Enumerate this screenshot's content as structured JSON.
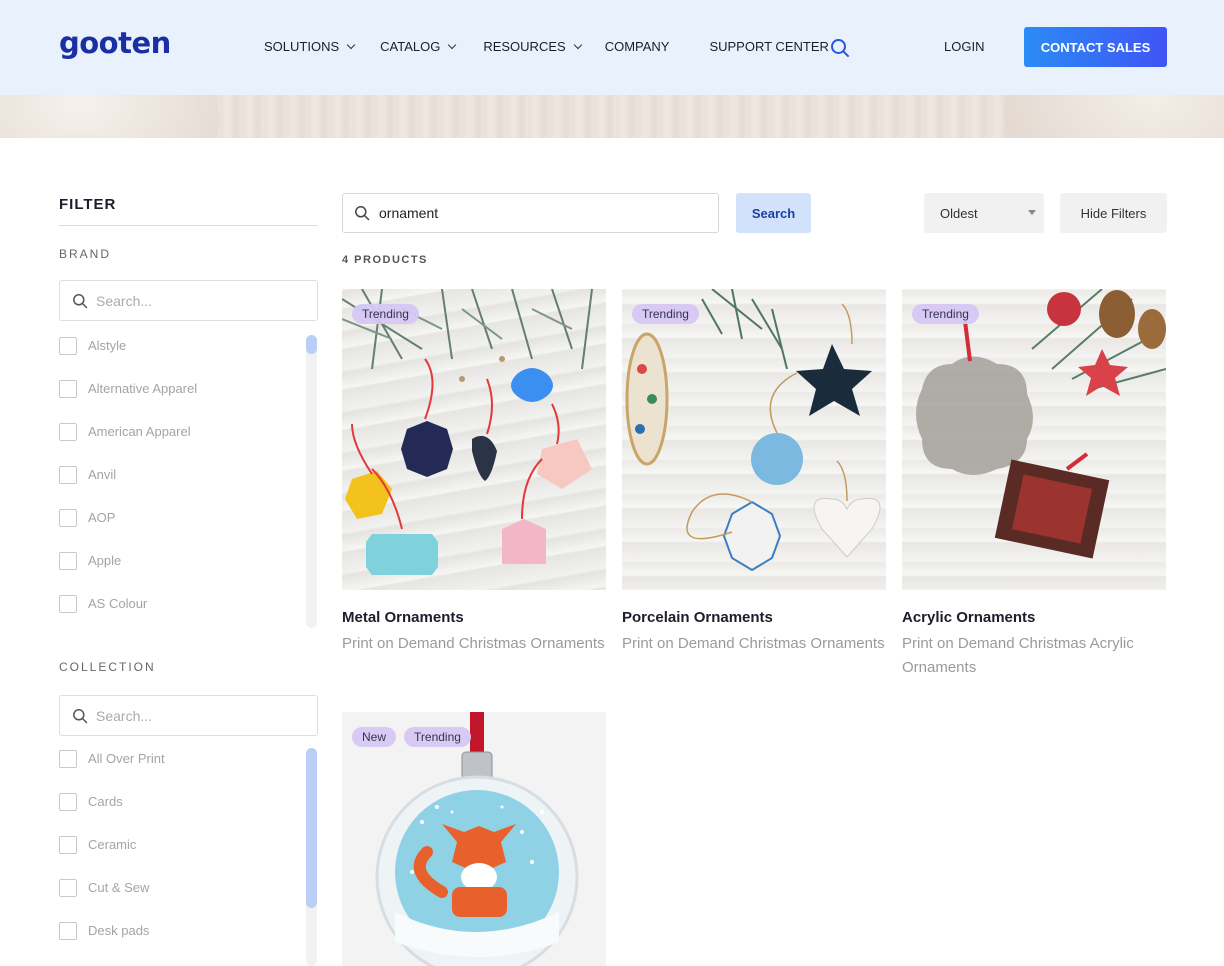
{
  "header": {
    "logo": "gooten",
    "nav": [
      {
        "label": "SOLUTIONS",
        "dropdown": true
      },
      {
        "label": "CATALOG",
        "dropdown": true
      },
      {
        "label": "RESOURCES",
        "dropdown": true
      },
      {
        "label": "COMPANY",
        "dropdown": false
      },
      {
        "label": "SUPPORT CENTER",
        "dropdown": false
      }
    ],
    "login": "LOGIN",
    "contact": "CONTACT SALES",
    "colors": {
      "bg": "#e9f1fc",
      "logo": "#1a2fa3",
      "cta_from": "#2a8cf5",
      "cta_to": "#4054f5"
    }
  },
  "filter": {
    "title": "FILTER",
    "brand": {
      "label": "BRAND",
      "search_placeholder": "Search...",
      "items": [
        "Alstyle",
        "Alternative Apparel",
        "American Apparel",
        "Anvil",
        "AOP",
        "Apple",
        "AS Colour"
      ]
    },
    "collection": {
      "label": "COLLECTION",
      "search_placeholder": "Search...",
      "items": [
        "All Over Print",
        "Cards",
        "Ceramic",
        "Cut & Sew",
        "Desk pads"
      ]
    }
  },
  "search": {
    "value": "ornament",
    "button": "Search",
    "sort": "Oldest",
    "hide_filters": "Hide Filters"
  },
  "results": {
    "count_label": "4 PRODUCTS"
  },
  "products": [
    {
      "title": "Metal Ornaments",
      "subtitle": "Print on Demand Christmas Ornaments",
      "badges": [
        "Trending"
      ]
    },
    {
      "title": "Porcelain Ornaments",
      "subtitle": "Print on Demand Christmas Ornaments",
      "badges": [
        "Trending"
      ]
    },
    {
      "title": "Acrylic Ornaments",
      "subtitle": "Print on Demand Christmas Acrylic Ornaments",
      "badges": [
        "Trending"
      ]
    },
    {
      "title": "",
      "subtitle": "",
      "badges": [
        "New",
        "Trending"
      ]
    }
  ]
}
